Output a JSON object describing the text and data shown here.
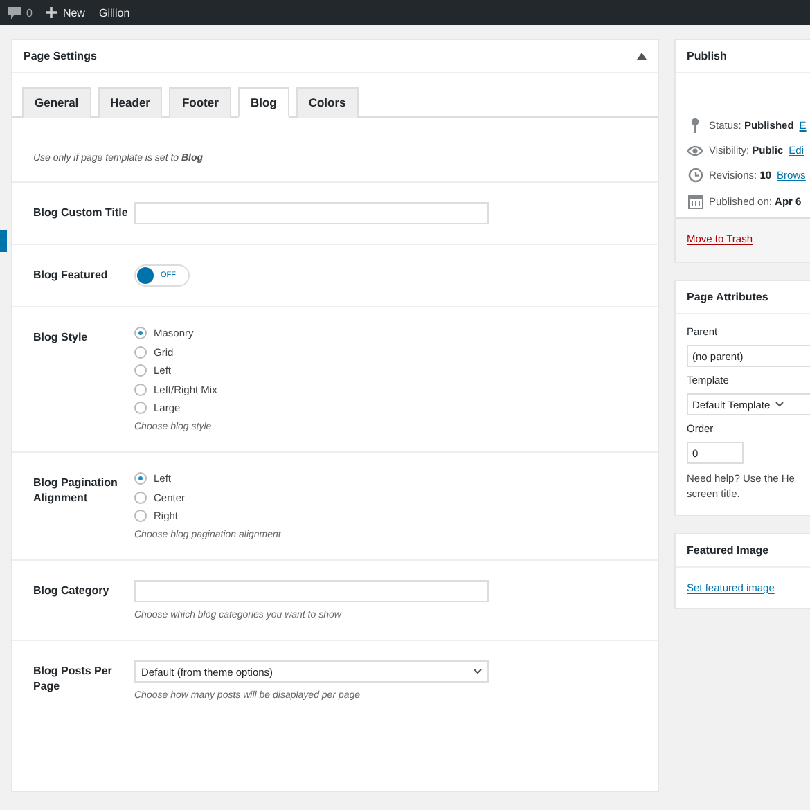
{
  "admin_bar": {
    "comments_count": "0",
    "new_label": "New",
    "site_name": "Gillion"
  },
  "page_settings": {
    "title": "Page Settings",
    "tabs": [
      {
        "label": "General",
        "selected": false
      },
      {
        "label": "Header",
        "selected": false
      },
      {
        "label": "Footer",
        "selected": false
      },
      {
        "label": "Blog",
        "selected": true
      },
      {
        "label": "Colors",
        "selected": false
      }
    ],
    "note": "Use only if page template is set to **Blog**",
    "fields": [
      {
        "kind": "text",
        "label": "Blog Custom Title"
      },
      {
        "kind": "toggle",
        "label": "Blog Featured",
        "on": false,
        "state_text": "OFF"
      },
      {
        "kind": "radio",
        "label": "Blog Style",
        "options": [
          {
            "label": "Masonry",
            "selected": true
          },
          {
            "label": "Grid",
            "selected": false
          },
          {
            "label": "Left",
            "selected": false
          },
          {
            "label": "Left/Right Mix",
            "selected": false
          },
          {
            "label": "Large",
            "selected": false
          }
        ],
        "description": "Choose blog style"
      },
      {
        "kind": "radio",
        "label": "Blog Pagination Alignment",
        "options": [
          {
            "label": "Left",
            "selected": true
          },
          {
            "label": "Center",
            "selected": false
          },
          {
            "label": "Right",
            "selected": false
          }
        ],
        "description": "Choose blog pagination alignment"
      },
      {
        "kind": "text",
        "label": "Blog Category",
        "description": "Choose which blog categories you want to show"
      },
      {
        "kind": "select",
        "label": "Blog Posts Per Page",
        "value": "Default (from theme options)",
        "description": "Choose how many posts will be disaplayed per page"
      }
    ]
  },
  "publish": {
    "title": "Publish",
    "items": [
      {
        "kind": "status",
        "text": "Status: **Published**",
        "link": "E"
      },
      {
        "kind": "visibility",
        "text": "Visibility: **Public**",
        "link": "Edi"
      },
      {
        "kind": "revisions",
        "text": "Revisions: **10**",
        "link": "Brows"
      },
      {
        "kind": "date",
        "text": "Published on: **Apr 6**"
      }
    ],
    "trash_link": "Move to Trash"
  },
  "page_attributes": {
    "title": "Page Attributes",
    "parent_label": "Parent",
    "parent_value": "(no parent)",
    "template_label": "Template",
    "template_value": "Default Template",
    "order_label": "Order",
    "order_value": "0",
    "help_lines": [
      "Need help? Use the He",
      "screen title."
    ]
  },
  "featured_image": {
    "title": "Featured Image",
    "link": "Set featured image"
  }
}
